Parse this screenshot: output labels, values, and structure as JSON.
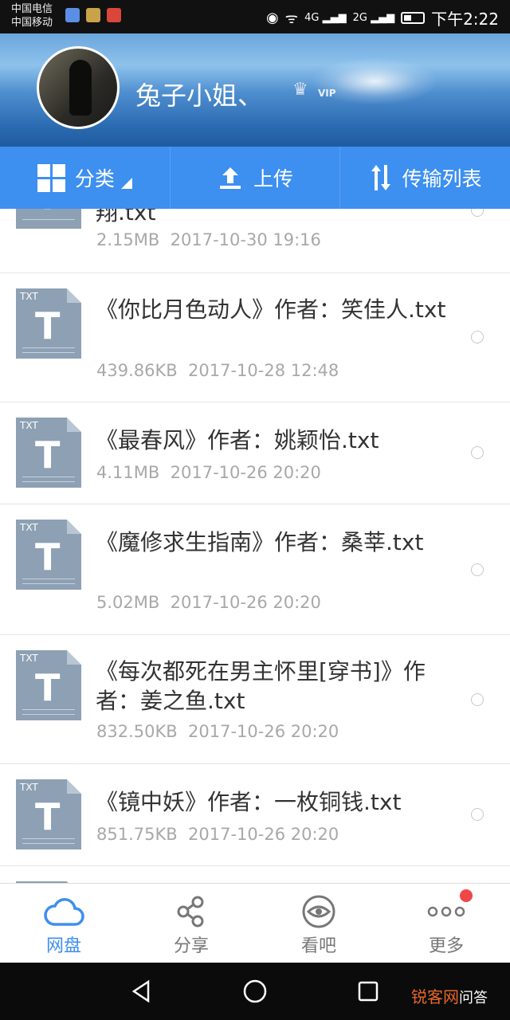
{
  "status_bar": {
    "carrier1": "中国电信",
    "carrier2": "中国移动",
    "network1": "4G",
    "network2": "2G",
    "time": "下午2:22"
  },
  "header": {
    "username": "兔子小姐、",
    "vip_label": "VIP"
  },
  "toolbar": {
    "category": "分类",
    "upload": "上传",
    "transfer_list": "传输列表"
  },
  "files": [
    {
      "name": "翔.txt",
      "size": "2.15MB",
      "date": "2017-10-30  19:16"
    },
    {
      "name": "《你比月色动人》作者：笑佳人.txt",
      "size": "439.86KB",
      "date": "2017-10-28  12:48"
    },
    {
      "name": "《最春风》作者：姚颖怡.txt",
      "size": "4.11MB",
      "date": "2017-10-26  20:20"
    },
    {
      "name": "《魔修求生指南》作者：桑莘.txt",
      "size": "5.02MB",
      "date": "2017-10-26  20:20"
    },
    {
      "name": "《每次都死在男主怀里[穿书]》作者：姜之鱼.txt",
      "size": "832.50KB",
      "date": "2017-10-26  20:20"
    },
    {
      "name": "《镜中妖》作者：一枚铜钱.txt",
      "size": "851.75KB",
      "date": "2017-10-26  20:20"
    }
  ],
  "file_icon_label": "TXT",
  "file_icon_letter": "T",
  "bottom_nav": {
    "netdisk": "网盘",
    "share": "分享",
    "watch": "看吧",
    "more": "更多"
  },
  "watermark": {
    "part1": "锐客网",
    "part2": "问答"
  },
  "colors": {
    "accent": "#3d8ff0",
    "badge": "#f04646",
    "file_icon": "#8da0b4"
  }
}
